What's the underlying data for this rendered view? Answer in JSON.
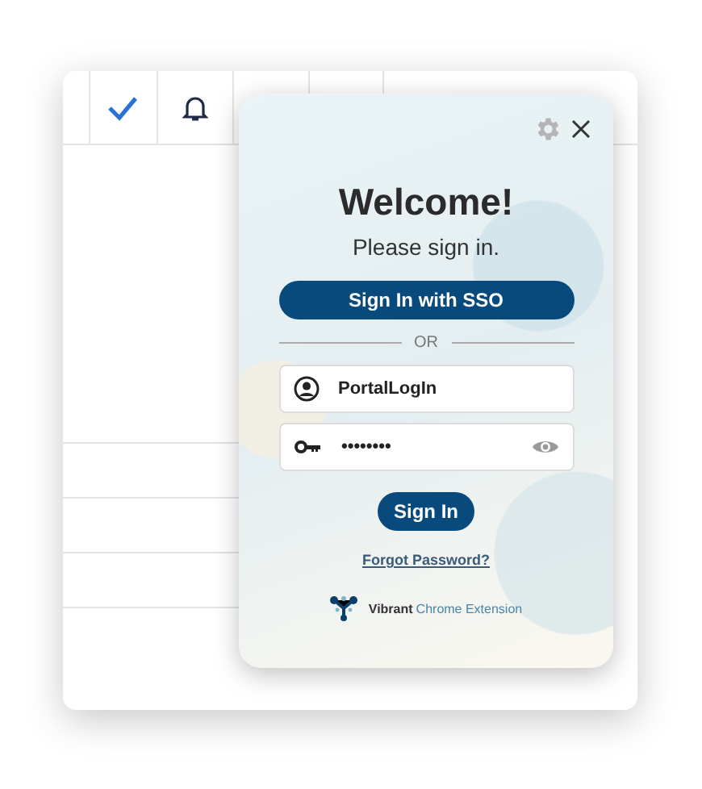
{
  "popup": {
    "title": "Welcome!",
    "subtitle": "Please sign in.",
    "sso_button": "Sign In with SSO",
    "divider": "OR",
    "username": {
      "value": "PortalLogIn"
    },
    "password": {
      "value": "••••••••"
    },
    "sign_in_button": "Sign In",
    "forgot_link": "Forgot Password?",
    "brand": {
      "name": "Vibrant",
      "product": "Chrome Extension"
    }
  }
}
